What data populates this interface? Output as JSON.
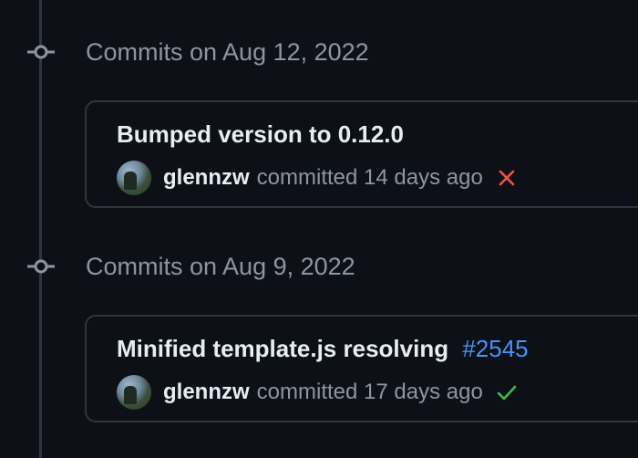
{
  "groups": [
    {
      "header": "Commits on Aug 12, 2022",
      "commit": {
        "title": "Bumped version to 0.12.0",
        "pr_link": "",
        "author": "glennzw",
        "committed": "committed 14 days ago",
        "status": "failure",
        "status_icon": "x-icon",
        "status_color": "#f85149"
      }
    },
    {
      "header": "Commits on Aug 9, 2022",
      "commit": {
        "title": "Minified template.js resolving",
        "pr_link": "#2545",
        "author": "glennzw",
        "committed": "committed 17 days ago",
        "status": "success",
        "status_icon": "check-icon",
        "status_color": "#3fb950"
      }
    }
  ],
  "colors": {
    "background": "#0d1117",
    "border": "#30363d",
    "muted_text": "#8d96a0",
    "link": "#4493f8"
  }
}
